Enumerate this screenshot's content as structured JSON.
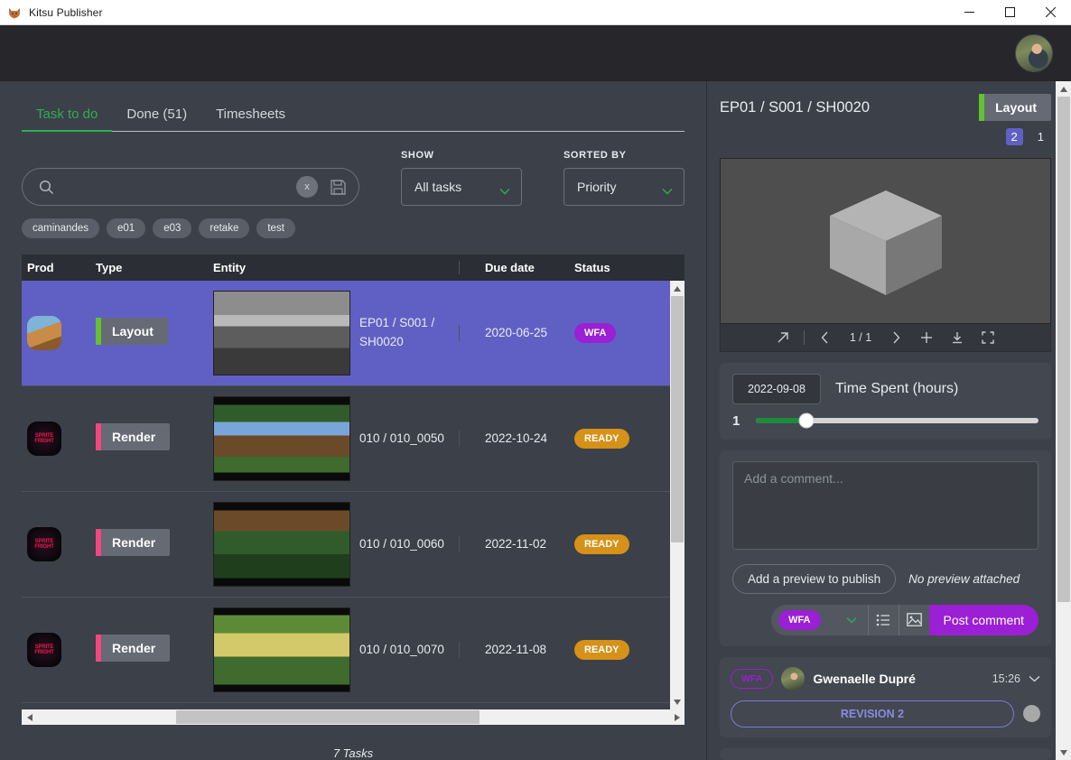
{
  "window": {
    "title": "Kitsu Publisher",
    "icon": "kitsu-fox-icon",
    "minimize": "–",
    "maximize": "□",
    "close": "✕"
  },
  "header": {
    "avatar": "user-avatar"
  },
  "tabs": [
    {
      "label": "Task to do",
      "active": true
    },
    {
      "label": "Done (51)",
      "active": false
    },
    {
      "label": "Timesheets",
      "active": false
    }
  ],
  "search": {
    "value": "",
    "placeholder": "",
    "clear_label": "x",
    "save_icon": "save-icon",
    "search_icon": "search-icon"
  },
  "filters": {
    "show": {
      "label": "SHOW",
      "value": "All tasks"
    },
    "sorted_by": {
      "label": "SORTED BY",
      "value": "Priority"
    }
  },
  "tags": [
    "caminandes",
    "e01",
    "e03",
    "retake",
    "test"
  ],
  "table": {
    "columns": [
      "Prod",
      "Type",
      "Entity",
      "Due date",
      "Status"
    ],
    "rows": [
      {
        "prod": "caminandes",
        "type": "Layout",
        "type_color": "#63c132",
        "entity": "EP01 / S001 / SH0020",
        "due_date": "2020-06-25",
        "status": "WFA",
        "status_color": "#9b1fd4",
        "selected": true,
        "thumb": "caminandes-llama-bw"
      },
      {
        "prod": "spritefright",
        "type": "Render",
        "type_color": "#f0487f",
        "entity": "010 / 010_0050",
        "due_date": "2022-10-24",
        "status": "READY",
        "status_color": "#d59118",
        "selected": false,
        "thumb": "forest-log"
      },
      {
        "prod": "spritefright",
        "type": "Render",
        "type_color": "#f0487f",
        "entity": "010 / 010_0060",
        "due_date": "2022-11-02",
        "status": "READY",
        "status_color": "#d59118",
        "selected": false,
        "thumb": "forest-character"
      },
      {
        "prod": "spritefright",
        "type": "Render",
        "type_color": "#f0487f",
        "entity": "010 / 010_0070",
        "due_date": "2022-11-08",
        "status": "READY",
        "status_color": "#d59118",
        "selected": false,
        "thumb": "mushroom-fish"
      }
    ],
    "footer": "7 Tasks"
  },
  "detail": {
    "title": "EP01 / S001 / SH0020",
    "task_type": "Layout",
    "task_type_color": "#63c132",
    "versions": [
      {
        "label": "2",
        "active": true
      },
      {
        "label": "1",
        "active": false
      }
    ],
    "preview": {
      "content": "3d-cube-render"
    },
    "preview_toolbar": {
      "open_icon": "external-link-icon",
      "prev_icon": "chevron-left-icon",
      "page": "1 / 1",
      "next_icon": "chevron-right-icon",
      "add_icon": "plus-icon",
      "download_icon": "download-icon",
      "fullscreen_icon": "fullscreen-icon"
    },
    "timespent": {
      "date": "2022-09-08",
      "label": "Time Spent (hours)",
      "value": "1"
    },
    "comment": {
      "placeholder": "Add a comment...",
      "value": "",
      "add_preview_label": "Add a preview to publish",
      "no_preview_text": "No preview attached",
      "status": "WFA",
      "status_color": "#9b1fd4",
      "checklist_icon": "checklist-icon",
      "attachment_icon": "image-icon",
      "post_label": "Post comment"
    },
    "comments": [
      {
        "status": "WFA",
        "author": "Gwenaelle Dupré",
        "time": "15:26",
        "revision": "REVISION 2",
        "chevron": "chevron-down-icon"
      }
    ]
  }
}
